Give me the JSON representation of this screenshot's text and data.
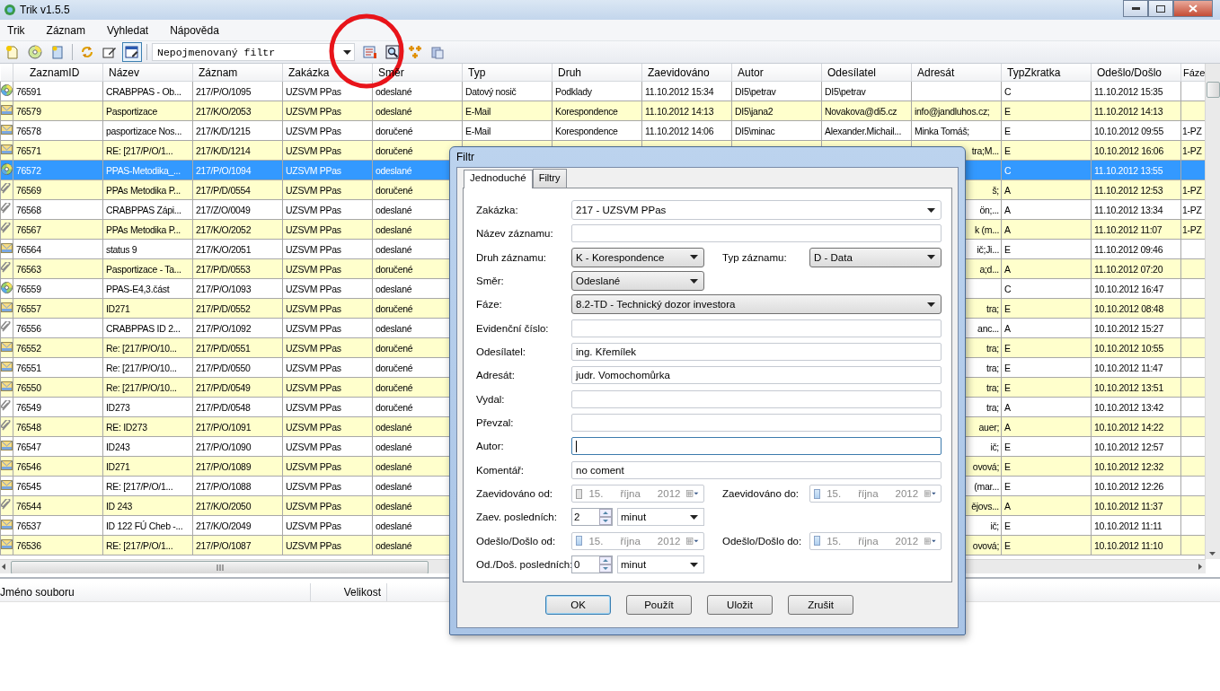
{
  "app_window": {
    "title": "Trik v1.5.5"
  },
  "menu": [
    "Trik",
    "Záznam",
    "Vyhledat",
    "Nápověda"
  ],
  "toolbar": {
    "left_buttons": [
      {
        "kind": "new",
        "pressed": false
      },
      {
        "kind": "disc",
        "pressed": false
      },
      {
        "kind": "note",
        "pressed": false
      },
      {
        "kind": "refresh",
        "pressed": false
      },
      {
        "kind": "edit",
        "pressed": false
      },
      {
        "kind": "window",
        "pressed": true
      }
    ],
    "filter": "Nepojmenovaný filtr",
    "right_buttons": [
      {
        "kind": "list",
        "pressed": false
      },
      {
        "kind": "zoom",
        "pressed": false
      },
      {
        "kind": "tree",
        "pressed": false
      },
      {
        "kind": "copy",
        "pressed": false
      }
    ]
  },
  "table": {
    "columns": [
      "ZaznamID",
      "Název",
      "Záznam",
      "Zakázka",
      "Směr",
      "Typ",
      "Druh",
      "Zaevidováno",
      "Autor",
      "Odesílatel",
      "Adresát",
      "TypZkratka",
      "Odešlo/Došlo",
      "Fáze"
    ],
    "rows": [
      {
        "kind": "disc",
        "selected": false,
        "id": "76591",
        "name": "CRABPPAS - Ob...",
        "record": "217/P/O/1095",
        "contract": "UZSVM PPas",
        "direction": "odeslané",
        "type": "Datový nosič",
        "category": "Podklady",
        "registered": "11.10.2012 15:34",
        "author": "DI5\\petrav",
        "sender": "DI5\\petrav",
        "type_code": "C",
        "sent_received": "11.10.2012 15:35"
      },
      {
        "kind": "mail",
        "selected": false,
        "id": "76579",
        "name": "Pasportizace",
        "record": "217/K/O/2053",
        "contract": "UZSVM PPas",
        "direction": "odeslané",
        "type": "E-Mail",
        "category": "Korespondence",
        "registered": "11.10.2012 14:13",
        "author": "DI5\\jana2",
        "sender": "Novakova@di5.cz",
        "recipient": "info@jandluhos.cz;",
        "type_code": "E",
        "sent_received": "11.10.2012 14:13"
      },
      {
        "kind": "mail",
        "selected": false,
        "id": "76578",
        "name": "pasportizace Nos...",
        "record": "217/K/D/1215",
        "contract": "UZSVM PPas",
        "direction": "doručené",
        "type": "E-Mail",
        "category": "Korespondence",
        "registered": "11.10.2012 14:06",
        "author": "DI5\\minac",
        "sender": "Alexander.Michail...",
        "recipient": "Minka Tomáš;",
        "type_code": "E",
        "sent_received": "10.10.2012 09:55",
        "phase": "1-PZ"
      },
      {
        "kind": "mail",
        "selected": false,
        "id": "76571",
        "name": "RE: [217/P/O/1...",
        "record": "217/K/D/1214",
        "contract": "UZSVM PPas",
        "direction": "doručené",
        "recipient": "tra;M...",
        "type_code": "E",
        "sent_received": "10.10.2012 16:06",
        "phase": "1-PZ"
      },
      {
        "kind": "disc",
        "selected": true,
        "id": "76572",
        "name": "PPAS-Metodika_...",
        "record": "217/P/O/1094",
        "contract": "UZSVM PPas",
        "direction": "odeslané",
        "type_code": "C",
        "sent_received": "11.10.2012 13:55"
      },
      {
        "kind": "clip",
        "selected": false,
        "id": "76569",
        "name": "PPAs Metodika P...",
        "record": "217/P/D/0554",
        "contract": "UZSVM PPas",
        "direction": "doručené",
        "recipient": "š;",
        "type_code": "A",
        "sent_received": "11.10.2012 12:53",
        "phase": "1-PZ"
      },
      {
        "kind": "clip",
        "selected": false,
        "id": "76568",
        "name": "CRABPPAS Zápi...",
        "record": "217/Z/O/0049",
        "contract": "UZSVM PPas",
        "direction": "odeslané",
        "recipient": "ön;...",
        "type_code": "A",
        "sent_received": "11.10.2012 13:34",
        "phase": "1-PZ"
      },
      {
        "kind": "clip",
        "selected": false,
        "id": "76567",
        "name": "PPAs Metodika P...",
        "record": "217/K/O/2052",
        "contract": "UZSVM PPas",
        "direction": "odeslané",
        "recipient": "k (m...",
        "type_code": "A",
        "sent_received": "11.10.2012 11:07",
        "phase": "1-PZ"
      },
      {
        "kind": "mail",
        "selected": false,
        "id": "76564",
        "name": "status 9",
        "record": "217/K/O/2051",
        "contract": "UZSVM PPas",
        "direction": "odeslané",
        "recipient": "ič;Ji...",
        "type_code": "E",
        "sent_received": "11.10.2012 09:46"
      },
      {
        "kind": "clip",
        "selected": false,
        "id": "76563",
        "name": "Pasportizace - Ta...",
        "record": "217/P/D/0553",
        "contract": "UZSVM PPas",
        "direction": "doručené",
        "recipient": "a;d...",
        "type_code": "A",
        "sent_received": "11.10.2012 07:20"
      },
      {
        "kind": "disc",
        "selected": false,
        "id": "76559",
        "name": "PPAS-E4,3.část",
        "record": "217/P/O/1093",
        "contract": "UZSVM PPas",
        "direction": "odeslané",
        "type_code": "C",
        "sent_received": "10.10.2012 16:47"
      },
      {
        "kind": "mail",
        "selected": false,
        "id": "76557",
        "name": "ID271",
        "record": "217/P/D/0552",
        "contract": "UZSVM PPas",
        "direction": "doručené",
        "recipient": "tra;",
        "type_code": "E",
        "sent_received": "10.10.2012 08:48"
      },
      {
        "kind": "clip",
        "selected": false,
        "id": "76556",
        "name": "CRABPPAS ID 2...",
        "record": "217/P/O/1092",
        "contract": "UZSVM PPas",
        "direction": "odeslané",
        "recipient": "anc...",
        "type_code": "A",
        "sent_received": "10.10.2012 15:27"
      },
      {
        "kind": "mail",
        "selected": false,
        "id": "76552",
        "name": "Re: [217/P/O/10...",
        "record": "217/P/D/0551",
        "contract": "UZSVM PPas",
        "direction": "doručené",
        "recipient": "tra;",
        "type_code": "E",
        "sent_received": "10.10.2012 10:55"
      },
      {
        "kind": "mail",
        "selected": false,
        "id": "76551",
        "name": "Re: [217/P/O/10...",
        "record": "217/P/D/0550",
        "contract": "UZSVM PPas",
        "direction": "doručené",
        "recipient": "tra;",
        "type_code": "E",
        "sent_received": "10.10.2012 11:47"
      },
      {
        "kind": "mail",
        "selected": false,
        "id": "76550",
        "name": "Re: [217/P/O/10...",
        "record": "217/P/D/0549",
        "contract": "UZSVM PPas",
        "direction": "doručené",
        "recipient": "tra;",
        "type_code": "E",
        "sent_received": "10.10.2012 13:51"
      },
      {
        "kind": "clip",
        "selected": false,
        "id": "76549",
        "name": "ID273",
        "record": "217/P/D/0548",
        "contract": "UZSVM PPas",
        "direction": "doručené",
        "recipient": "tra;",
        "type_code": "A",
        "sent_received": "10.10.2012 13:42"
      },
      {
        "kind": "clip",
        "selected": false,
        "id": "76548",
        "name": "RE: ID273",
        "record": "217/P/O/1091",
        "contract": "UZSVM PPas",
        "direction": "odeslané",
        "recipient": "auer;",
        "type_code": "A",
        "sent_received": "10.10.2012 14:22"
      },
      {
        "kind": "mail",
        "selected": false,
        "id": "76547",
        "name": "ID243",
        "record": "217/P/O/1090",
        "contract": "UZSVM PPas",
        "direction": "odeslané",
        "recipient": "ič;",
        "type_code": "E",
        "sent_received": "10.10.2012 12:57"
      },
      {
        "kind": "mail",
        "selected": false,
        "id": "76546",
        "name": "ID271",
        "record": "217/P/O/1089",
        "contract": "UZSVM PPas",
        "direction": "odeslané",
        "recipient": "ovová;",
        "type_code": "E",
        "sent_received": "10.10.2012 12:32"
      },
      {
        "kind": "mail",
        "selected": false,
        "id": "76545",
        "name": "RE: [217/P/O/1...",
        "record": "217/P/O/1088",
        "contract": "UZSVM PPas",
        "direction": "odeslané",
        "recipient": "(mar...",
        "type_code": "E",
        "sent_received": "10.10.2012 12:26"
      },
      {
        "kind": "clip",
        "selected": false,
        "id": "76544",
        "name": "ID 243",
        "record": "217/K/O/2050",
        "contract": "UZSVM PPas",
        "direction": "odeslané",
        "recipient": "ějovs...",
        "type_code": "A",
        "sent_received": "10.10.2012 11:37"
      },
      {
        "kind": "mail",
        "selected": false,
        "id": "76537",
        "name": "ID 122 FÚ Cheb -...",
        "record": "217/K/O/2049",
        "contract": "UZSVM PPas",
        "direction": "odeslané",
        "recipient": "ič;",
        "type_code": "E",
        "sent_received": "10.10.2012 11:11"
      },
      {
        "kind": "mail",
        "selected": false,
        "id": "76536",
        "name": "RE: [217/P/O/1...",
        "record": "217/P/O/1087",
        "contract": "UZSVM PPas",
        "direction": "odeslané",
        "recipient": "ovová;",
        "type_code": "E",
        "sent_received": "10.10.2012 11:10"
      }
    ]
  },
  "file_panel": {
    "columns": [
      "Jméno souboru",
      "Velikost"
    ]
  },
  "dialog": {
    "title": "Filtr",
    "tabs": [
      {
        "label": "Jednoduché",
        "selected": true
      },
      {
        "label": "Filtry",
        "selected": false
      }
    ],
    "form": [
      {
        "kind": "combo",
        "label": "Zakázka:",
        "value": "217 - UZSVM PPas"
      },
      {
        "kind": "text",
        "label": "Název záznamu:",
        "focused": false
      },
      {
        "kind": "pair",
        "cells": [
          {
            "kind": "combo",
            "label": "Druh záznamu:",
            "value": "K - Korespondence"
          },
          {
            "kind": "combo",
            "label": "Typ záznamu:",
            "value": "D - Data"
          }
        ]
      },
      {
        "kind": "pair",
        "cells": [
          {
            "kind": "combo",
            "label": "Směr:",
            "value": "Odeslané"
          }
        ]
      },
      {
        "kind": "combo",
        "label": "Fáze:",
        "value": "8.2-TD - Technický dozor investora"
      },
      {
        "kind": "text",
        "label": "Evidenční číslo:",
        "focused": false
      },
      {
        "kind": "text",
        "label": "Odesílatel:",
        "value": "ing. Křemílek",
        "focused": false
      },
      {
        "kind": "text",
        "label": "Adresát:",
        "value": "judr. Vomochomůrka",
        "focused": false
      },
      {
        "kind": "text",
        "label": "Vydal:",
        "focused": false
      },
      {
        "kind": "text",
        "label": "Převzal:",
        "focused": false
      },
      {
        "kind": "text",
        "label": "Autor:",
        "focused": true
      },
      {
        "kind": "text",
        "label": "Komentář:",
        "value": "no coment",
        "focused": false
      },
      {
        "kind": "pair",
        "cells": [
          {
            "kind": "date",
            "label": "Zaevidováno od:",
            "checked": false,
            "disabled": true,
            "day": "15.",
            "month": "října",
            "year": "2012"
          },
          {
            "kind": "date",
            "label": "Zaevidováno do:",
            "checked": false,
            "disabled": false,
            "day": "15.",
            "month": "října",
            "year": "2012"
          }
        ]
      },
      {
        "kind": "pair",
        "cells": [
          {
            "kind": "spin",
            "label": "Zaev. posledních:",
            "value": "2",
            "unit": "minut"
          }
        ]
      },
      {
        "kind": "pair",
        "cells": [
          {
            "kind": "date",
            "label": "Odešlo/Došlo od:",
            "checked": false,
            "disabled": false,
            "day": "15.",
            "month": "října",
            "year": "2012"
          },
          {
            "kind": "date",
            "label": "Odešlo/Došlo do:",
            "checked": false,
            "disabled": false,
            "day": "15.",
            "month": "října",
            "year": "2012"
          }
        ]
      },
      {
        "kind": "pair",
        "cells": [
          {
            "kind": "spin",
            "label": "Od./Doš. posledních:",
            "value": "0",
            "unit": "minut"
          }
        ]
      }
    ],
    "buttons": [
      {
        "label": "OK",
        "default": true
      },
      {
        "label": "Použít",
        "default": false
      },
      {
        "label": "Uložit",
        "default": false
      },
      {
        "label": "Zrušit",
        "default": false
      }
    ]
  }
}
